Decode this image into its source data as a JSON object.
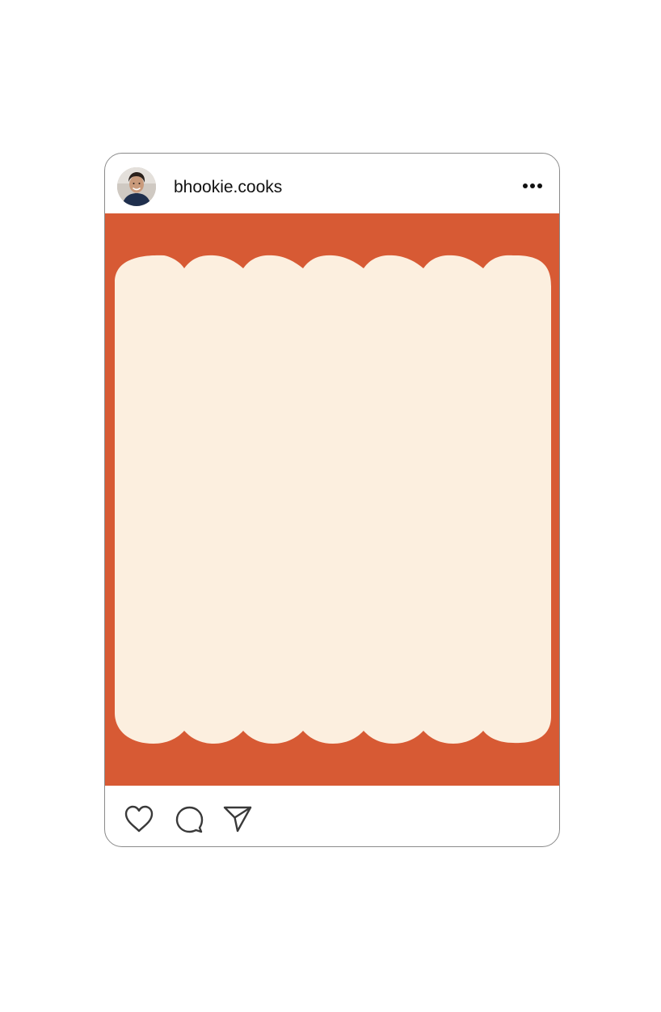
{
  "post": {
    "username": "bhookie.cooks",
    "avatar_icon": "profile-photo",
    "more_icon": "more-horizontal-icon",
    "image": {
      "background_color": "#D75A34",
      "panel_color": "#FCEFDF",
      "shape": "scalloped-panel"
    },
    "actions": [
      {
        "icon": "heart-icon"
      },
      {
        "icon": "comment-icon"
      },
      {
        "icon": "send-icon"
      }
    ]
  }
}
